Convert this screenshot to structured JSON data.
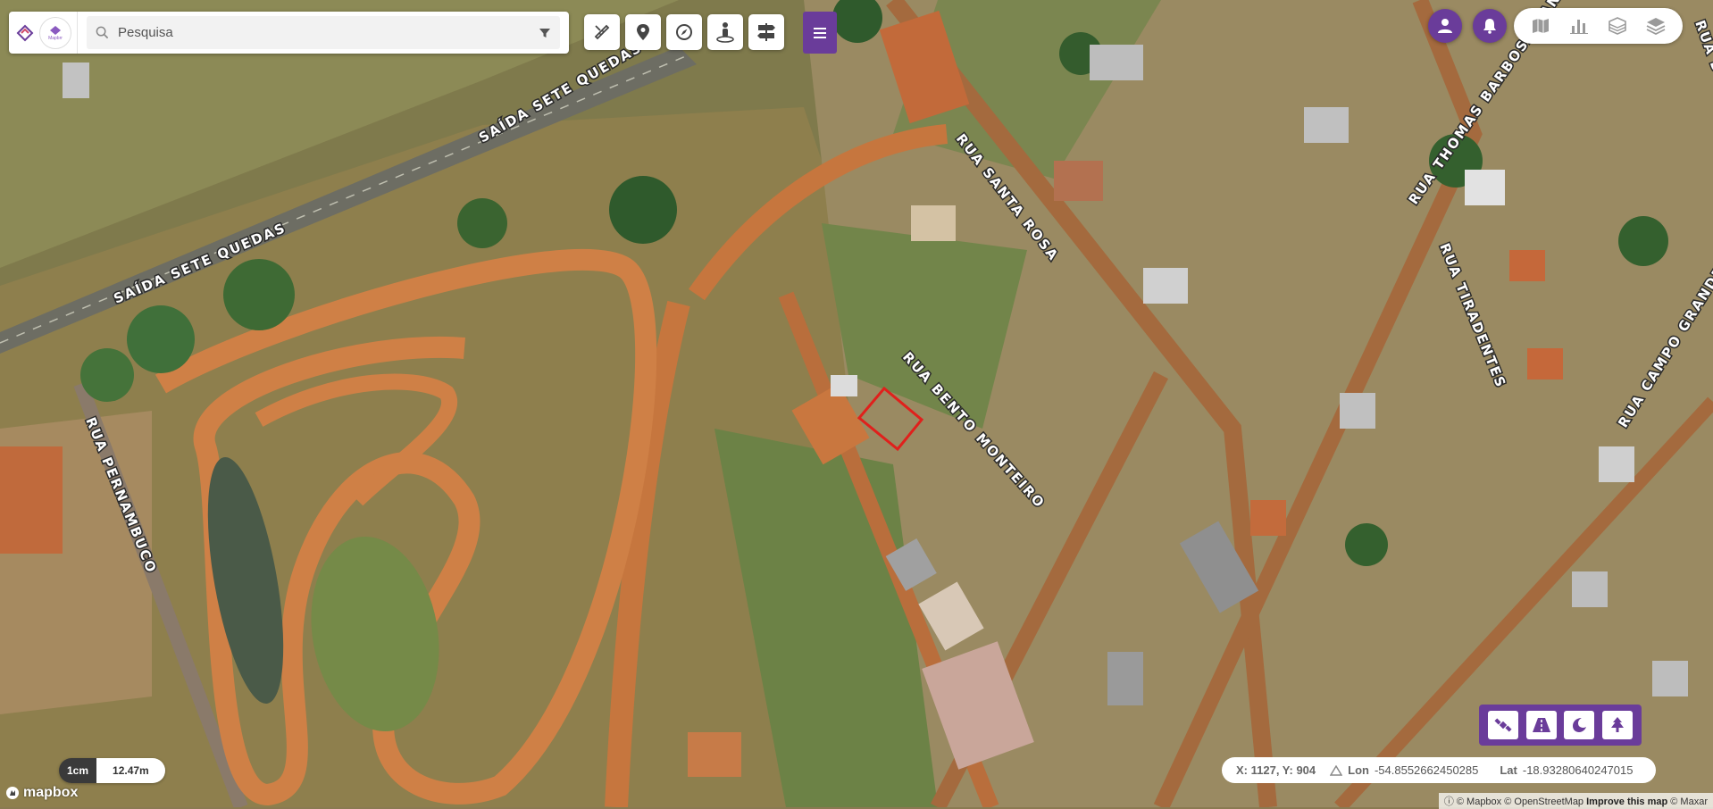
{
  "search": {
    "placeholder": "Pesquisa"
  },
  "header": {
    "logo_icon": "brand-logo-icon",
    "logo_text": "Mapbrr"
  },
  "toolbar": {
    "tools": [
      {
        "icon": "measure-icon"
      },
      {
        "icon": "map-pin-icon"
      },
      {
        "icon": "compass-icon"
      },
      {
        "icon": "street-view-icon"
      },
      {
        "icon": "signpost-icon"
      }
    ],
    "menu_icon": "hamburger-icon"
  },
  "top_right": {
    "user_icon": "user-icon",
    "notifications_icon": "bell-icon",
    "layers": [
      {
        "icon": "map-layer-icon"
      },
      {
        "icon": "bar-chart-icon"
      },
      {
        "icon": "building-layer-icon"
      },
      {
        "icon": "stack-layers-icon"
      }
    ]
  },
  "map_styles": [
    {
      "icon": "satellite-icon"
    },
    {
      "icon": "road-icon"
    },
    {
      "icon": "moon-icon"
    },
    {
      "icon": "tree-icon"
    }
  ],
  "streets": [
    "SAÍDA SETE QUEDAS",
    "SAÍDA SETE QUEDAS",
    "RUA SANTA ROSA",
    "RUA THOMAS BARBOSA RANGEL",
    "RUA TIRADENTES",
    "RUA BENTO MONTEIRO",
    "RUA PERNAMBUCO",
    "RUA CAMPO GRANDE",
    "RUA DOM"
  ],
  "coordinates": {
    "xy": "X: 1127, Y: 904",
    "lon_label": "Lon",
    "lon_value": "-54.8552662450285",
    "lat_label": "Lat",
    "lat_value": "-18.93280640247015"
  },
  "scale": {
    "unit": "1cm",
    "value": "12.47m"
  },
  "mapbox_logo": "mapbox",
  "attribution": {
    "mapbox": "© Mapbox",
    "osm": "© OpenStreetMap",
    "improve": "Improve this map",
    "maxar": "© Maxar"
  },
  "colors": {
    "accent": "#6a3c9a",
    "parcel_outline": "#e0201c"
  }
}
